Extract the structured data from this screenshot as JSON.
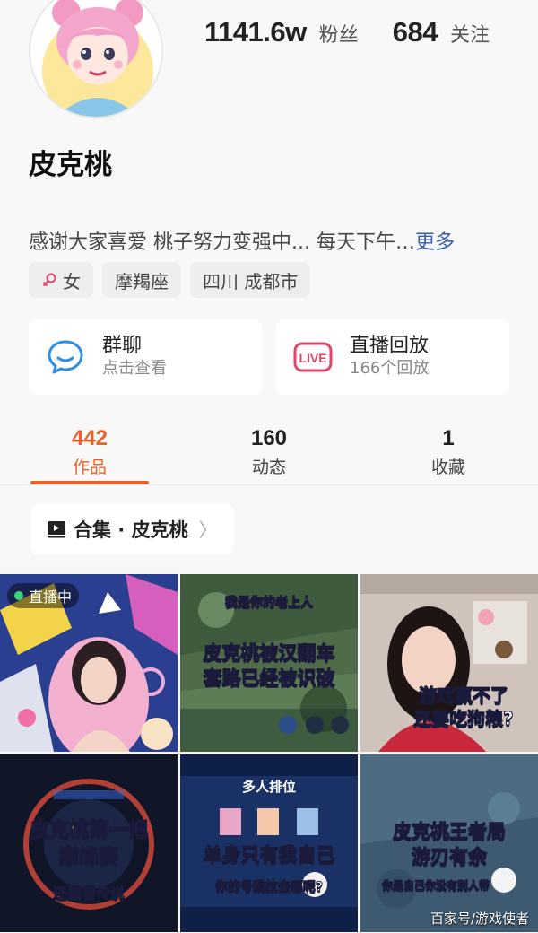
{
  "profile": {
    "name": "皮克桃",
    "stats": {
      "followers_value": "1141.6w",
      "followers_label": "粉丝",
      "following_value": "684",
      "following_label": "关注"
    },
    "bio": "感谢大家喜爱 桃子努力变强中... 每天下午…",
    "bio_more": "更多",
    "tags": {
      "gender": "女",
      "zodiac": "摩羯座",
      "location": "四川 成都市"
    }
  },
  "cards": {
    "group_chat": {
      "title": "群聊",
      "subtitle": "点击查看",
      "icon": "chat-bubble-icon"
    },
    "live_replay": {
      "title": "直播回放",
      "subtitle": "166个回放",
      "icon": "live-icon",
      "icon_text": "LIVE"
    }
  },
  "tabs": [
    {
      "count": "442",
      "label": "作品",
      "active": true
    },
    {
      "count": "160",
      "label": "动态",
      "active": false
    },
    {
      "count": "1",
      "label": "收藏",
      "active": false
    }
  ],
  "collection": {
    "label": "合集 · 皮克桃",
    "chevron": "〉"
  },
  "grid": {
    "live_badge": "直播中",
    "captions": {
      "v2_top": "我是你的老上人",
      "v2_line1": "皮克桃被汉翻车",
      "v2_line2": "套路已经被识破",
      "v3_line1": "游戏赢不了",
      "v3_line2": "还要吃狗粮?",
      "v4_line1": "皮克桃第一把",
      "v4_line2": "巅峰赛",
      "v4_line3": "还翻看传说",
      "v5_header": "多人排位",
      "v5_line1": "单身只有我自己",
      "v5_line2": "你的号我拉去哪呢?",
      "v6_line1": "皮克桃王者局",
      "v6_line2": "游刃有余",
      "v6_line3": "你是自己你没有别人带"
    }
  },
  "watermark": "百家号/游戏使者",
  "colors": {
    "accent": "#e8622c",
    "link": "#3a5da8",
    "live": "#e0456a",
    "chat": "#2f8ee6"
  }
}
